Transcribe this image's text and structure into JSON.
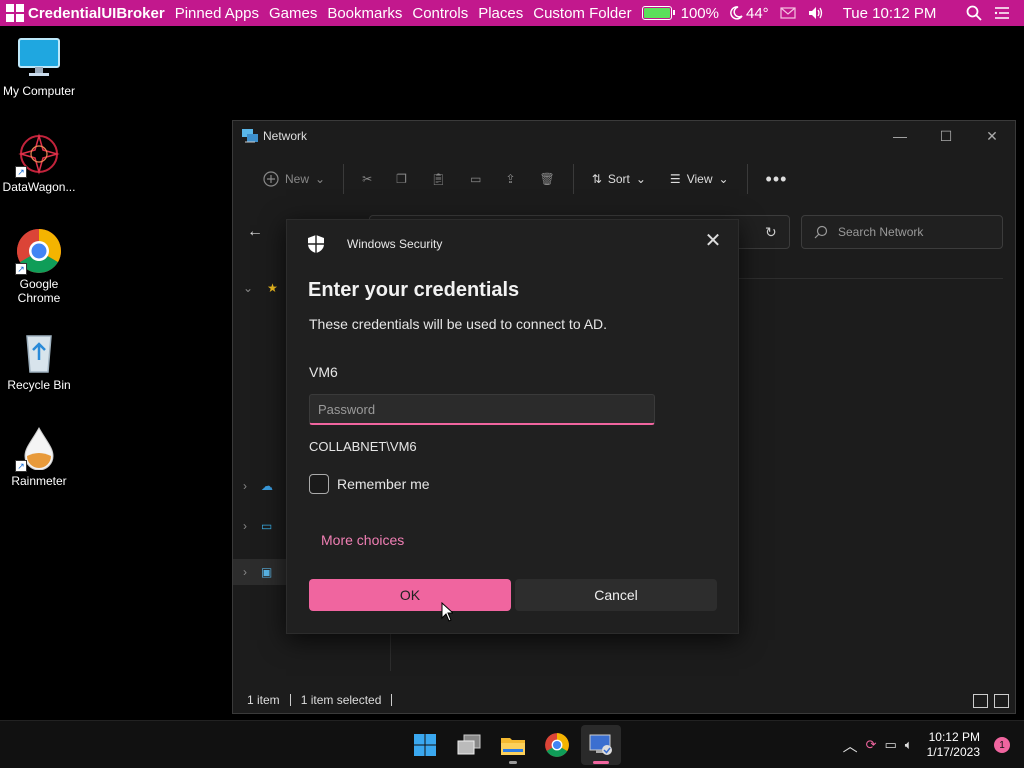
{
  "menubar": {
    "app_name": "CredentialUIBroker",
    "items": [
      "Pinned Apps",
      "Games",
      "Bookmarks",
      "Controls",
      "Places",
      "Custom Folder"
    ],
    "battery": "100%",
    "weather": "44°",
    "datetime": "Tue 10:12 PM",
    "battery_level": 1.0
  },
  "desktop": {
    "icons": [
      {
        "label": "My Computer",
        "icon": "monitor-icon"
      },
      {
        "label": "DataWagon...",
        "icon": "datawagon-icon"
      },
      {
        "label": "Google Chrome",
        "icon": "chrome-icon"
      },
      {
        "label": "Recycle Bin",
        "icon": "recycle-bin-icon"
      },
      {
        "label": "Rainmeter",
        "icon": "rainmeter-icon"
      }
    ]
  },
  "explorer": {
    "title": "Network",
    "toolbar": {
      "new_label": "New",
      "sort_label": "Sort",
      "view_label": "View"
    },
    "search_placeholder": "Search Network",
    "status": {
      "count": "1 item",
      "selected": "1 item selected"
    }
  },
  "dialog": {
    "header": "Windows Security",
    "title": "Enter your credentials",
    "subtitle": "These credentials will be used to connect to AD.",
    "username": "VM6",
    "password_placeholder": "Password",
    "domain": "COLLABNET\\VM6",
    "remember_label": "Remember me",
    "more_choices": "More choices",
    "ok_label": "OK",
    "cancel_label": "Cancel"
  },
  "taskbar": {
    "time": "10:12 PM",
    "date": "1/17/2023",
    "notifications": "1"
  },
  "colors": {
    "accent": "#f0659f",
    "menubar": "#c2188d"
  }
}
